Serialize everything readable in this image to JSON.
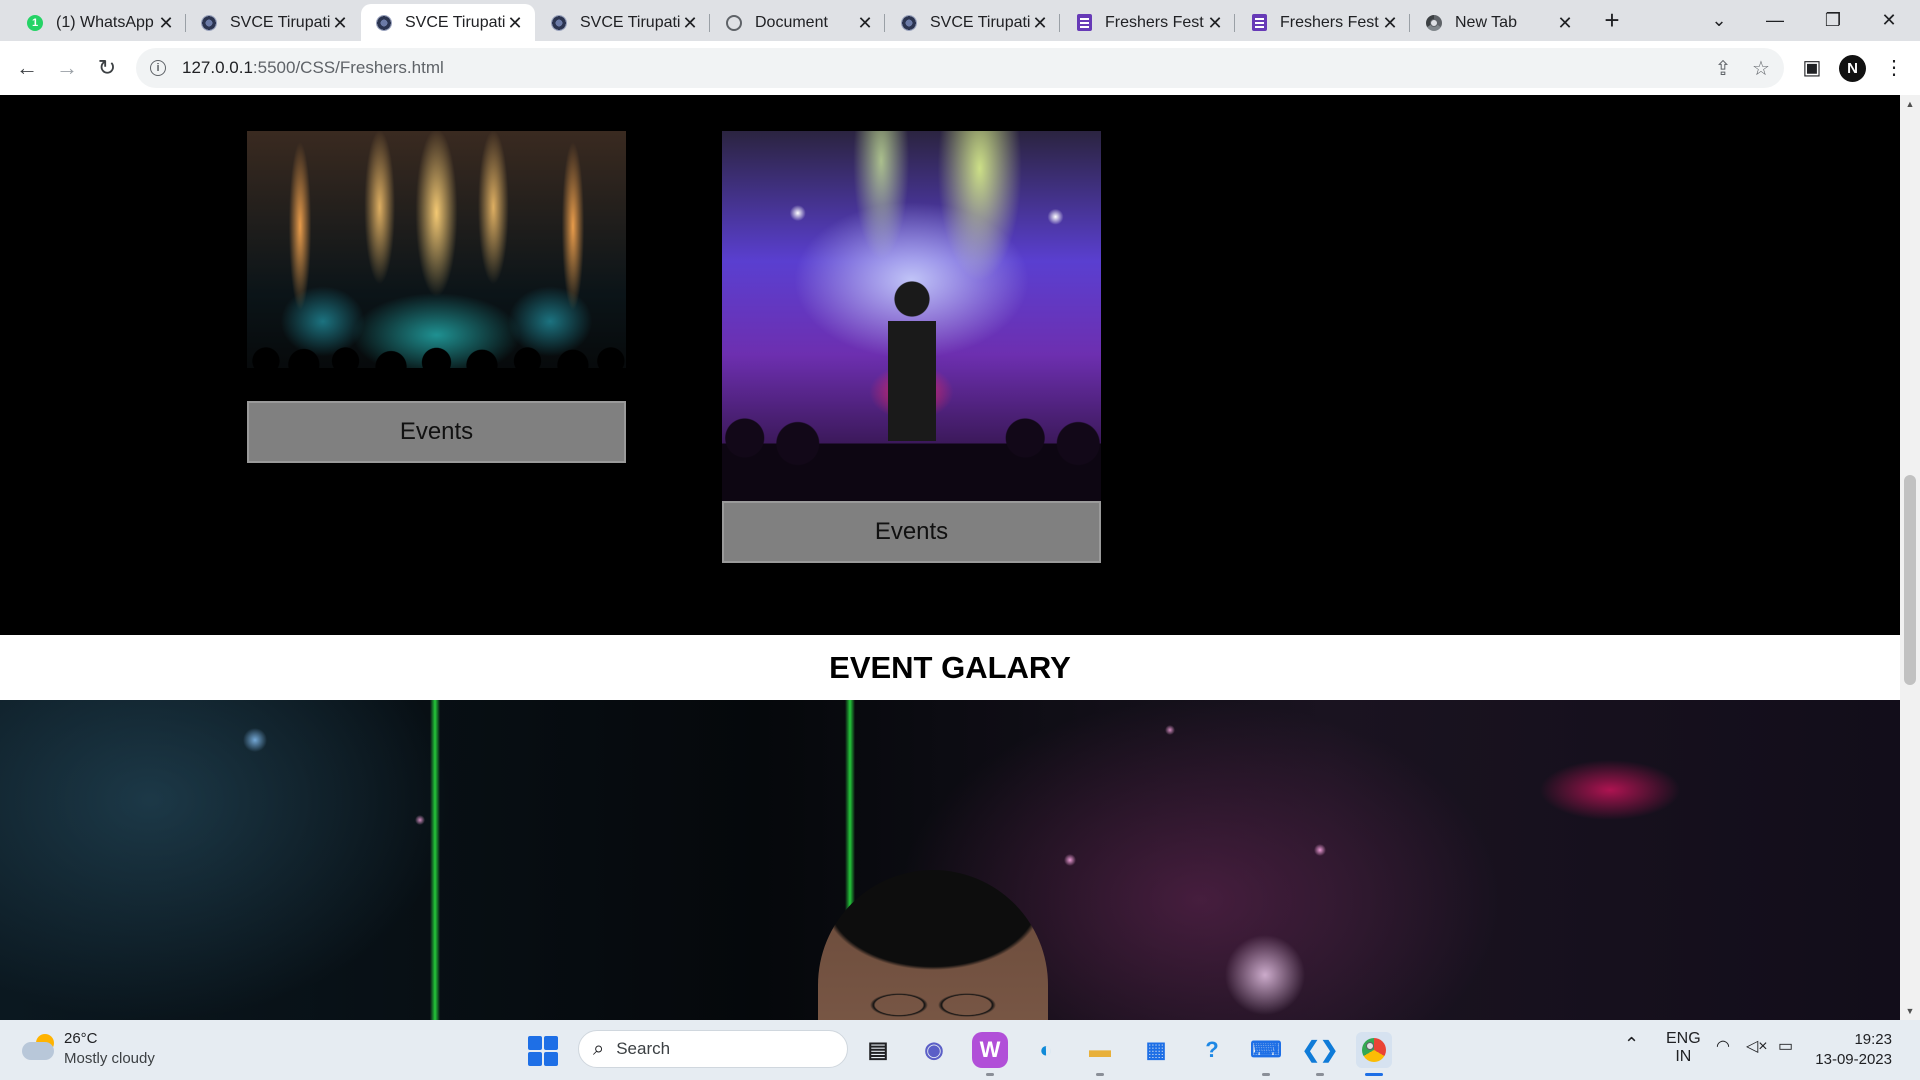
{
  "browser": {
    "tabs": [
      {
        "title": "(1) WhatsApp",
        "icon": "whatsapp-icon",
        "active": false
      },
      {
        "title": "SVCE Tirupati",
        "icon": "svce-logo-icon",
        "active": false
      },
      {
        "title": "SVCE Tirupati",
        "icon": "svce-logo-icon",
        "active": true
      },
      {
        "title": "SVCE Tirupati",
        "icon": "svce-logo-icon",
        "active": false
      },
      {
        "title": "Document",
        "icon": "globe-icon",
        "active": false
      },
      {
        "title": "SVCE Tirupati",
        "icon": "svce-logo-icon",
        "active": false
      },
      {
        "title": "Freshers Fest R",
        "icon": "google-forms-icon",
        "active": false
      },
      {
        "title": "Freshers Fest R",
        "icon": "google-forms-icon",
        "active": false
      },
      {
        "title": "New Tab",
        "icon": "chrome-icon",
        "active": false
      }
    ],
    "whatsapp_badge": "1",
    "url_host": "127.0.0.1",
    "url_rest": ":5500/CSS/Freshers.html",
    "profile_initial": "N"
  },
  "page": {
    "cards": [
      {
        "caption": "Events",
        "image": "concert-stage-orange-lights"
      },
      {
        "caption": "Events",
        "image": "dj-stage-purple-lights"
      }
    ],
    "gallery_title": "EVENT GALARY"
  },
  "taskbar": {
    "weather_temp": "26°C",
    "weather_desc": "Mostly cloudy",
    "search_placeholder": "Search",
    "lang_1": "ENG",
    "lang_2": "IN",
    "time": "19:23",
    "date": "13-09-2023"
  },
  "colors": {
    "page_background": "#000000",
    "card_caption_bg": "#808080",
    "gallery_bar_bg": "#ffffff",
    "tabstrip_bg": "#dfe1e5",
    "taskbar_bg": "#e6ecf2"
  }
}
